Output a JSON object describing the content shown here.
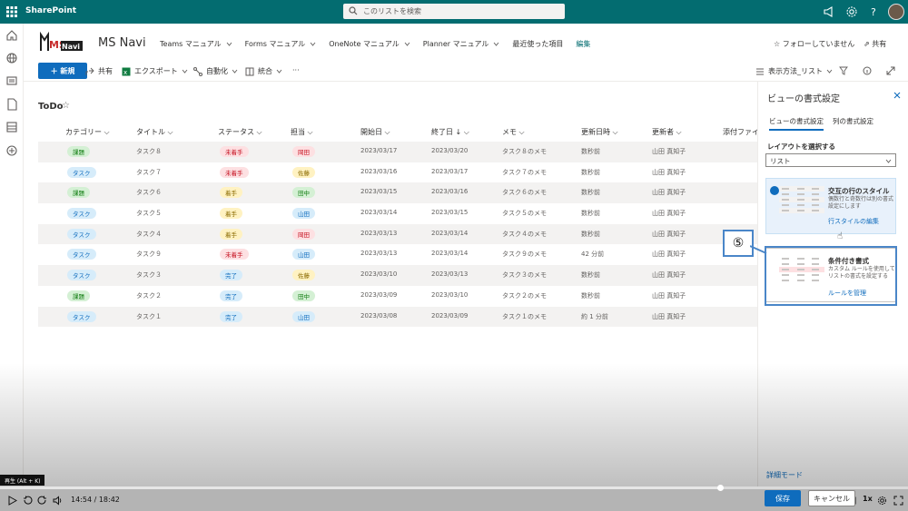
{
  "topbar": {
    "brand": "SharePoint",
    "search_placeholder": "このリストを検索"
  },
  "site": {
    "logo_text_ms": "MS",
    "logo_text_navi": "Navi",
    "title": "MS Navi",
    "nav": [
      "Teams マニュアル",
      "Forms マニュアル",
      "OneNote マニュアル",
      "Planner マニュアル",
      "最近使った項目"
    ],
    "edit_label": "編集",
    "follow_label": "フォローしていません",
    "share_label": "共有"
  },
  "commands": {
    "new_label": "新規",
    "share": "共有",
    "export": "エクスポート",
    "automate": "自動化",
    "integrate": "統合",
    "more": "···",
    "view_options": "表示方法_リスト"
  },
  "list": {
    "title": "ToDo",
    "headers": [
      "カテゴリー",
      "タイトル",
      "ステータス",
      "担当",
      "開始日",
      "終了日",
      "メモ",
      "更新日時",
      "更新者",
      "添付ファイ"
    ],
    "sort_arrow": "↓",
    "rows": [
      {
        "category": "課題",
        "title": "タスク８",
        "status": "未着手",
        "owner": "岡田",
        "start": "2023/03/17",
        "end": "2023/03/20",
        "memo": "タスク８のメモ",
        "modified": "数秒前",
        "editor": "山田 真知子"
      },
      {
        "category": "タスク",
        "title": "タスク７",
        "status": "未着手",
        "owner": "佐藤",
        "start": "2023/03/16",
        "end": "2023/03/17",
        "memo": "タスク７のメモ",
        "modified": "数秒前",
        "editor": "山田 真知子"
      },
      {
        "category": "課題",
        "title": "タスク６",
        "status": "着手",
        "owner": "田中",
        "start": "2023/03/15",
        "end": "2023/03/16",
        "memo": "タスク６のメモ",
        "modified": "数秒前",
        "editor": "山田 真知子"
      },
      {
        "category": "タスク",
        "title": "タスク５",
        "status": "着手",
        "owner": "山田",
        "start": "2023/03/14",
        "end": "2023/03/15",
        "memo": "タスク５のメモ",
        "modified": "数秒前",
        "editor": "山田 真知子"
      },
      {
        "category": "タスク",
        "title": "タスク４",
        "status": "着手",
        "owner": "岡田",
        "start": "2023/03/13",
        "end": "2023/03/14",
        "memo": "タスク４のメモ",
        "modified": "数秒前",
        "editor": "山田 真知子"
      },
      {
        "category": "タスク",
        "title": "タスク９",
        "status": "未着手",
        "owner": "山田",
        "start": "2023/03/13",
        "end": "2023/03/14",
        "memo": "タスク９のメモ",
        "modified": "42 分前",
        "editor": "山田 真知子"
      },
      {
        "category": "タスク",
        "title": "タスク３",
        "status": "完了",
        "owner": "佐藤",
        "start": "2023/03/10",
        "end": "2023/03/13",
        "memo": "タスク３のメモ",
        "modified": "数秒前",
        "editor": "山田 真知子"
      },
      {
        "category": "課題",
        "title": "タスク２",
        "status": "完了",
        "owner": "田中",
        "start": "2023/03/09",
        "end": "2023/03/10",
        "memo": "タスク２のメモ",
        "modified": "数秒前",
        "editor": "山田 真知子"
      },
      {
        "category": "タスク",
        "title": "タスク１",
        "status": "完了",
        "owner": "山田",
        "start": "2023/03/08",
        "end": "2023/03/09",
        "memo": "タスク１のメモ",
        "modified": "約 1 分前",
        "editor": "山田 真知子"
      }
    ]
  },
  "pill_colors": {
    "課題": {
      "bg": "#d4f0d4",
      "fg": "#107c10"
    },
    "タスク": {
      "bg": "#d6ecfa",
      "fg": "#0f6cbd"
    },
    "未着手": {
      "bg": "#fde0e2",
      "fg": "#c50f1f"
    },
    "着手": {
      "bg": "#fff2c2",
      "fg": "#8a6a00"
    },
    "完了": {
      "bg": "#d6ecfa",
      "fg": "#0f6cbd"
    },
    "岡田": {
      "bg": "#fde0e2",
      "fg": "#c50f1f"
    },
    "佐藤": {
      "bg": "#fff2c2",
      "fg": "#8a6a00"
    },
    "田中": {
      "bg": "#d4f0d4",
      "fg": "#107c10"
    },
    "山田": {
      "bg": "#d6ecfa",
      "fg": "#0f6cbd"
    }
  },
  "panel": {
    "title": "ビューの書式設定",
    "tab_view": "ビューの書式設定",
    "tab_column": "列の書式設定",
    "layout_label": "レイアウトを選択する",
    "layout_value": "リスト",
    "card1_title": "交互の行のスタイル",
    "card1_desc": "偶数行と奇数行は別の書式設定にします",
    "card1_link": "行スタイルの編集",
    "card2_title": "条件付き書式",
    "card2_desc": "カスタム ルールを使用してリストの書式を設定する",
    "card2_link": "ルールを管理",
    "advanced": "詳細モード",
    "save": "保存",
    "cancel": "キャンセル"
  },
  "annotation": {
    "callout_number": "⑤"
  },
  "player": {
    "tooltip": "再生 (Alt + K)",
    "time": "14:54 / 18:42",
    "progress": 0.793,
    "speed": "1x"
  },
  "colors": {
    "suite_bar": "#036c70",
    "accent": "#0f6cbd",
    "highlight_box": "#4a86c8"
  }
}
